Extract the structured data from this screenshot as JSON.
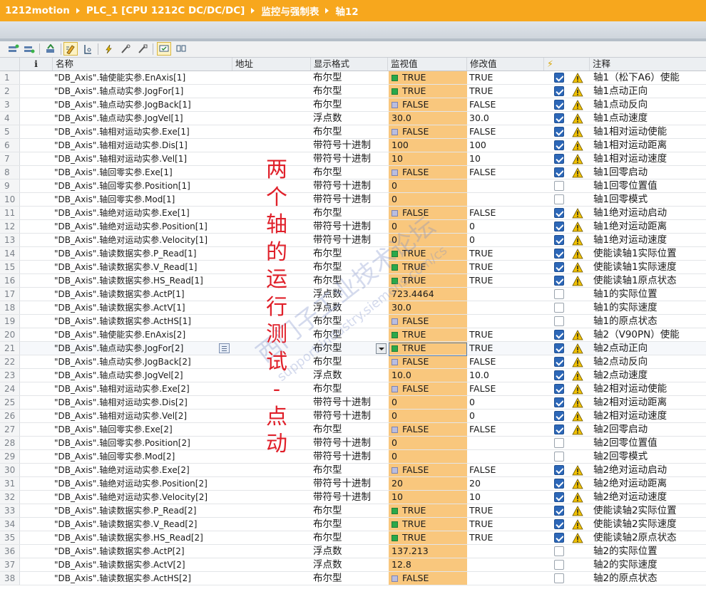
{
  "breadcrumb": [
    "1212motion",
    "PLC_1 [CPU 1212C DC/DC/DC]",
    "监控与强制表",
    "轴12"
  ],
  "toolbar_icons": [
    "add-row-icon",
    "insert-row-icon",
    "update-icon",
    "monitor-all-icon",
    "monitor-once-icon",
    "modify-now-icon",
    "modify-trigger-icon",
    "enable-peripheral-icon",
    "show-all-modify-icon",
    "show-hide-columns-icon"
  ],
  "columns": {
    "info": "ℹ",
    "name": "名称",
    "address": "地址",
    "format": "显示格式",
    "monitor": "监视值",
    "modify": "修改值",
    "force": "⚡",
    "comment": "注释"
  },
  "rows": [
    {
      "no": "1",
      "name": "\"DB_Axis\".轴使能实参.EnAxis[1]",
      "fmt": "布尔型",
      "mon": "TRUE",
      "sq": "t",
      "mod": "TRUE",
      "chk": true,
      "comment": "轴1（松下A6）使能"
    },
    {
      "no": "2",
      "name": "\"DB_Axis\".轴点动实参.JogFor[1]",
      "fmt": "布尔型",
      "mon": "TRUE",
      "sq": "t",
      "mod": "TRUE",
      "chk": true,
      "comment": "轴1点动正向"
    },
    {
      "no": "3",
      "name": "\"DB_Axis\".轴点动实参.JogBack[1]",
      "fmt": "布尔型",
      "mon": "FALSE",
      "sq": "f",
      "mod": "FALSE",
      "chk": true,
      "comment": "轴1点动反向"
    },
    {
      "no": "4",
      "name": "\"DB_Axis\".轴点动实参.JogVel[1]",
      "fmt": "浮点数",
      "mon": "30.0",
      "sq": "",
      "mod": "30.0",
      "chk": true,
      "comment": "轴1点动速度"
    },
    {
      "no": "5",
      "name": "\"DB_Axis\".轴相对运动实参.Exe[1]",
      "fmt": "布尔型",
      "mon": "FALSE",
      "sq": "f",
      "mod": "FALSE",
      "chk": true,
      "comment": "轴1相对运动使能"
    },
    {
      "no": "6",
      "name": "\"DB_Axis\".轴相对运动实参.Dis[1]",
      "fmt": "带符号十进制",
      "mon": "100",
      "sq": "",
      "mod": "100",
      "chk": true,
      "comment": "轴1相对运动距离"
    },
    {
      "no": "7",
      "name": "\"DB_Axis\".轴相对运动实参.Vel[1]",
      "fmt": "带符号十进制",
      "mon": "10",
      "sq": "",
      "mod": "10",
      "chk": true,
      "comment": "轴1相对运动速度"
    },
    {
      "no": "8",
      "name": "\"DB_Axis\".轴回零实参.Exe[1]",
      "fmt": "布尔型",
      "mon": "FALSE",
      "sq": "f",
      "mod": "FALSE",
      "chk": true,
      "comment": "轴1回零启动"
    },
    {
      "no": "9",
      "name": "\"DB_Axis\".轴回零实参.Position[1]",
      "fmt": "带符号十进制",
      "mon": "0",
      "sq": "",
      "mod": "",
      "chk": false,
      "comment": "轴1回零位置值"
    },
    {
      "no": "10",
      "name": "\"DB_Axis\".轴回零实参.Mod[1]",
      "fmt": "带符号十进制",
      "mon": "0",
      "sq": "",
      "mod": "",
      "chk": false,
      "comment": "轴1回零模式"
    },
    {
      "no": "11",
      "name": "\"DB_Axis\".轴绝对运动实参.Exe[1]",
      "fmt": "布尔型",
      "mon": "FALSE",
      "sq": "f",
      "mod": "FALSE",
      "chk": true,
      "comment": "轴1绝对运动启动"
    },
    {
      "no": "12",
      "name": "\"DB_Axis\".轴绝对运动实参.Position[1]",
      "fmt": "带符号十进制",
      "mon": "0",
      "sq": "",
      "mod": "0",
      "chk": true,
      "comment": "轴1绝对运动距离"
    },
    {
      "no": "13",
      "name": "\"DB_Axis\".轴绝对运动实参.Velocity[1]",
      "fmt": "带符号十进制",
      "mon": "0",
      "sq": "",
      "mod": "0",
      "chk": true,
      "comment": "轴1绝对运动速度"
    },
    {
      "no": "14",
      "name": "\"DB_Axis\".轴读数据实参.P_Read[1]",
      "fmt": "布尔型",
      "mon": "TRUE",
      "sq": "t",
      "mod": "TRUE",
      "chk": true,
      "comment": "使能读轴1实际位置"
    },
    {
      "no": "15",
      "name": "\"DB_Axis\".轴读数据实参.V_Read[1]",
      "fmt": "布尔型",
      "mon": "TRUE",
      "sq": "t",
      "mod": "TRUE",
      "chk": true,
      "comment": "使能读轴1实际速度"
    },
    {
      "no": "16",
      "name": "\"DB_Axis\".轴读数据实参.HS_Read[1]",
      "fmt": "布尔型",
      "mon": "TRUE",
      "sq": "t",
      "mod": "TRUE",
      "chk": true,
      "comment": "使能读轴1原点状态"
    },
    {
      "no": "17",
      "name": "\"DB_Axis\".轴读数据实参.ActP[1]",
      "fmt": "浮点数",
      "mon": "723.4464",
      "sq": "",
      "mod": "",
      "chk": false,
      "comment": "轴1的实际位置"
    },
    {
      "no": "18",
      "name": "\"DB_Axis\".轴读数据实参.ActV[1]",
      "fmt": "浮点数",
      "mon": "30.0",
      "sq": "",
      "mod": "",
      "chk": false,
      "comment": "轴1的实际速度"
    },
    {
      "no": "19",
      "name": "\"DB_Axis\".轴读数据实参.ActHS[1]",
      "fmt": "布尔型",
      "mon": "FALSE",
      "sq": "f",
      "mod": "",
      "chk": false,
      "comment": "轴1的原点状态"
    },
    {
      "no": "20",
      "name": "\"DB_Axis\".轴使能实参.EnAxis[2]",
      "fmt": "布尔型",
      "mon": "TRUE",
      "sq": "t",
      "mod": "TRUE",
      "chk": true,
      "comment": "轴2（V90PN）使能"
    },
    {
      "no": "21",
      "name": "\"DB_Axis\".轴点动实参.JogFor[2]",
      "fmt": "布尔型",
      "mon": "TRUE",
      "sq": "t",
      "mod": "TRUE",
      "chk": true,
      "comment": "轴2点动正向"
    },
    {
      "no": "22",
      "name": "\"DB_Axis\".轴点动实参.JogBack[2]",
      "fmt": "布尔型",
      "mon": "FALSE",
      "sq": "f",
      "mod": "FALSE",
      "chk": true,
      "comment": "轴2点动反向"
    },
    {
      "no": "23",
      "name": "\"DB_Axis\".轴点动实参.JogVel[2]",
      "fmt": "浮点数",
      "mon": "10.0",
      "sq": "",
      "mod": "10.0",
      "chk": true,
      "comment": "轴2点动速度"
    },
    {
      "no": "24",
      "name": "\"DB_Axis\".轴相对运动实参.Exe[2]",
      "fmt": "布尔型",
      "mon": "FALSE",
      "sq": "f",
      "mod": "FALSE",
      "chk": true,
      "comment": "轴2相对运动使能"
    },
    {
      "no": "25",
      "name": "\"DB_Axis\".轴相对运动实参.Dis[2]",
      "fmt": "带符号十进制",
      "mon": "0",
      "sq": "",
      "mod": "0",
      "chk": true,
      "comment": "轴2相对运动距离"
    },
    {
      "no": "26",
      "name": "\"DB_Axis\".轴相对运动实参.Vel[2]",
      "fmt": "带符号十进制",
      "mon": "0",
      "sq": "",
      "mod": "0",
      "chk": true,
      "comment": "轴2相对运动速度"
    },
    {
      "no": "27",
      "name": "\"DB_Axis\".轴回零实参.Exe[2]",
      "fmt": "布尔型",
      "mon": "FALSE",
      "sq": "f",
      "mod": "FALSE",
      "chk": true,
      "comment": "轴2回零启动"
    },
    {
      "no": "28",
      "name": "\"DB_Axis\".轴回零实参.Position[2]",
      "fmt": "带符号十进制",
      "mon": "0",
      "sq": "",
      "mod": "",
      "chk": false,
      "comment": "轴2回零位置值"
    },
    {
      "no": "29",
      "name": "\"DB_Axis\".轴回零实参.Mod[2]",
      "fmt": "带符号十进制",
      "mon": "0",
      "sq": "",
      "mod": "",
      "chk": false,
      "comment": "轴2回零模式"
    },
    {
      "no": "30",
      "name": "\"DB_Axis\".轴绝对运动实参.Exe[2]",
      "fmt": "布尔型",
      "mon": "FALSE",
      "sq": "f",
      "mod": "FALSE",
      "chk": true,
      "comment": "轴2绝对运动启动"
    },
    {
      "no": "31",
      "name": "\"DB_Axis\".轴绝对运动实参.Position[2]",
      "fmt": "带符号十进制",
      "mon": "20",
      "sq": "",
      "mod": "20",
      "chk": true,
      "comment": "轴2绝对运动距离"
    },
    {
      "no": "32",
      "name": "\"DB_Axis\".轴绝对运动实参.Velocity[2]",
      "fmt": "带符号十进制",
      "mon": "10",
      "sq": "",
      "mod": "10",
      "chk": true,
      "comment": "轴2绝对运动速度"
    },
    {
      "no": "33",
      "name": "\"DB_Axis\".轴读数据实参.P_Read[2]",
      "fmt": "布尔型",
      "mon": "TRUE",
      "sq": "t",
      "mod": "TRUE",
      "chk": true,
      "comment": "使能读轴2实际位置"
    },
    {
      "no": "34",
      "name": "\"DB_Axis\".轴读数据实参.V_Read[2]",
      "fmt": "布尔型",
      "mon": "TRUE",
      "sq": "t",
      "mod": "TRUE",
      "chk": true,
      "comment": "使能读轴2实际速度"
    },
    {
      "no": "35",
      "name": "\"DB_Axis\".轴读数据实参.HS_Read[2]",
      "fmt": "布尔型",
      "mon": "TRUE",
      "sq": "t",
      "mod": "TRUE",
      "chk": true,
      "comment": "使能读轴2原点状态"
    },
    {
      "no": "36",
      "name": "\"DB_Axis\".轴读数据实参.ActP[2]",
      "fmt": "浮点数",
      "mon": "137.213",
      "sq": "",
      "mod": "",
      "chk": false,
      "comment": "轴2的实际位置"
    },
    {
      "no": "37",
      "name": "\"DB_Axis\".轴读数据实参.ActV[2]",
      "fmt": "浮点数",
      "mon": "12.8",
      "sq": "",
      "mod": "",
      "chk": false,
      "comment": "轴2的实际速度"
    },
    {
      "no": "38",
      "name": "\"DB_Axis\".轴读数据实参.ActHS[2]",
      "fmt": "布尔型",
      "mon": "FALSE",
      "sq": "f",
      "mod": "",
      "chk": false,
      "comment": "轴2的原点状态"
    }
  ],
  "selected_row": "21",
  "overlay_text": "两\n个\n轴\n的\n运\n行\n测\n试\n-\n点\n动",
  "watermark_text": "西门子工业技术论坛",
  "watermark_sub": "support.industry.siemens.com/cs",
  "colors": {
    "accent": "#f7a71d",
    "monitor_cell": "#f9c77d",
    "true_square": "#2aa84a",
    "false_square": "#b9bde0",
    "checkbox": "#2c67b8",
    "warning": "#f2c200",
    "overlay": "#e0202a"
  }
}
